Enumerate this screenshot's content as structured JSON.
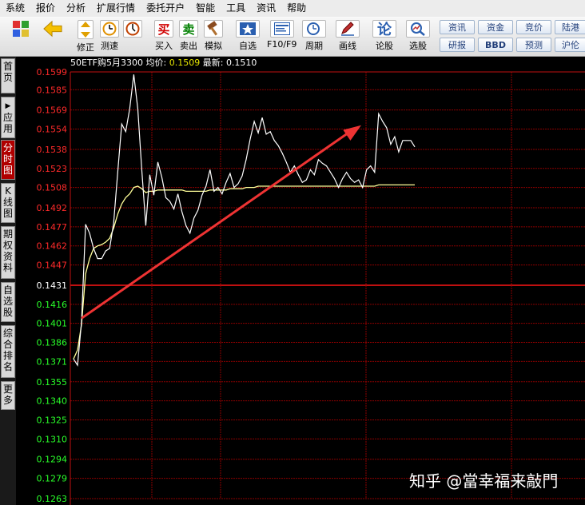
{
  "menu": [
    "系统",
    "报价",
    "分析",
    "扩展行情",
    "委托开户",
    "智能",
    "工具",
    "资讯",
    "帮助"
  ],
  "toolbar": {
    "buttons": [
      {
        "label": "",
        "icon": "blocks-icon"
      },
      {
        "label": "",
        "icon": "back-arrow-icon"
      },
      {
        "label": "修正",
        "icon": "up-down-arrow-icon"
      },
      {
        "label": "测速",
        "icon": "clock-icon"
      },
      {
        "label": "买入",
        "icon": "buy-icon",
        "glyph": "买"
      },
      {
        "label": "卖出",
        "icon": "sell-icon",
        "glyph": "卖"
      },
      {
        "label": "模拟",
        "icon": "hammer-icon"
      },
      {
        "label": "自选",
        "icon": "star-icon"
      },
      {
        "label": "F10/F9",
        "icon": "document-icon"
      },
      {
        "label": "周期",
        "icon": "cycle-icon"
      },
      {
        "label": "画线",
        "icon": "pencil-icon"
      },
      {
        "label": "论股",
        "icon": "discuss-icon",
        "glyph": "论"
      },
      {
        "label": "选股",
        "icon": "magnifier-chart-icon"
      }
    ],
    "right_buttons": [
      "资讯",
      "资金",
      "竞价",
      "陆港",
      "研报",
      "BBD",
      "预测",
      "沪伦"
    ]
  },
  "sidebar": [
    "首页",
    "应用",
    "分时图",
    "K线图",
    "期权资料",
    "自选股",
    "综合排名",
    "更多"
  ],
  "chart_header": {
    "name": "50ETF购5月3300",
    "avg_label": "均价:",
    "avg_value": "0.1509",
    "last_label": "最新:",
    "last_value": "0.1510"
  },
  "watermark": "知乎 @當幸福来敲門",
  "colors": {
    "up": "#ff2a2a",
    "down": "#2aff2a",
    "grid": "#8b0000",
    "price_line": "#ffffff",
    "avg_line": "#ffff99",
    "arrow": "#ee3333"
  },
  "chart_data": {
    "type": "line",
    "ylim": [
      0.1263,
      0.1599
    ],
    "prev_close": 0.1431,
    "y_ticks_up": [
      "0.1599",
      "0.1585",
      "0.1569",
      "0.1554",
      "0.1538",
      "0.1523",
      "0.1508",
      "0.1492",
      "0.1477",
      "0.1462",
      "0.1447"
    ],
    "y_tick_mid": "0.1431",
    "y_ticks_down": [
      "0.1416",
      "0.1401",
      "0.1386",
      "0.1371",
      "0.1355",
      "0.1340",
      "0.1325",
      "0.1310",
      "0.1294",
      "0.1279",
      "0.1263"
    ],
    "series": [
      {
        "values": [
          0.1373,
          0.1368,
          0.1402,
          0.1479,
          0.1472,
          0.146,
          0.1452,
          0.1452,
          0.1458,
          0.146,
          0.148,
          0.152,
          0.1558,
          0.1552,
          0.157,
          0.1597,
          0.157,
          0.1522,
          0.1478,
          0.1518,
          0.1502,
          0.1528,
          0.1516,
          0.15,
          0.1497,
          0.1491,
          0.1503,
          0.1489,
          0.1478,
          0.1472,
          0.1484,
          0.149,
          0.1502,
          0.1509,
          0.1522,
          0.1505,
          0.1508,
          0.1503,
          0.1512,
          0.1519,
          0.1508,
          0.1511,
          0.1517,
          0.153,
          0.1546,
          0.156,
          0.1551,
          0.1563,
          0.155,
          0.1552,
          0.1545,
          0.1541,
          0.1535,
          0.1528,
          0.152,
          0.1525,
          0.1518,
          0.1512,
          0.1514,
          0.1522,
          0.1518,
          0.153,
          0.1527,
          0.1525,
          0.152,
          0.1515,
          0.1508,
          0.1515,
          0.152,
          0.1515,
          0.1512,
          0.1514,
          0.1508,
          0.1522,
          0.1525,
          0.152,
          0.1566,
          0.156,
          0.1555,
          0.1542,
          0.1548,
          0.1536,
          0.1545,
          0.1545,
          0.1545,
          0.154
        ]
      },
      {
        "values": [
          0.1373,
          0.138,
          0.14,
          0.144,
          0.1452,
          0.146,
          0.1462,
          0.1463,
          0.1465,
          0.1468,
          0.1476,
          0.1487,
          0.1495,
          0.15,
          0.1503,
          0.1508,
          0.1509,
          0.1507,
          0.1504,
          0.1505,
          0.1505,
          0.1506,
          0.1506,
          0.1506,
          0.1506,
          0.1506,
          0.1506,
          0.1506,
          0.1505,
          0.1505,
          0.1505,
          0.1505,
          0.1505,
          0.1505,
          0.1506,
          0.1506,
          0.1506,
          0.1506,
          0.1506,
          0.1507,
          0.1507,
          0.1507,
          0.1507,
          0.1508,
          0.1508,
          0.1508,
          0.1509,
          0.1509,
          0.1509,
          0.1509,
          0.1509,
          0.1509,
          0.1509,
          0.1509,
          0.1509,
          0.1509,
          0.1509,
          0.1509,
          0.1509,
          0.1509,
          0.1509,
          0.1509,
          0.1509,
          0.1509,
          0.1509,
          0.1509,
          0.1509,
          0.1509,
          0.1509,
          0.1509,
          0.1509,
          0.1509,
          0.1509,
          0.1509,
          0.1509,
          0.1509,
          0.151,
          0.151,
          0.151,
          0.151,
          0.151,
          0.151,
          0.151,
          0.151,
          0.151,
          0.151
        ]
      }
    ],
    "annotation_arrow": {
      "from_value": 0.1405,
      "to_value": 0.1557
    }
  }
}
